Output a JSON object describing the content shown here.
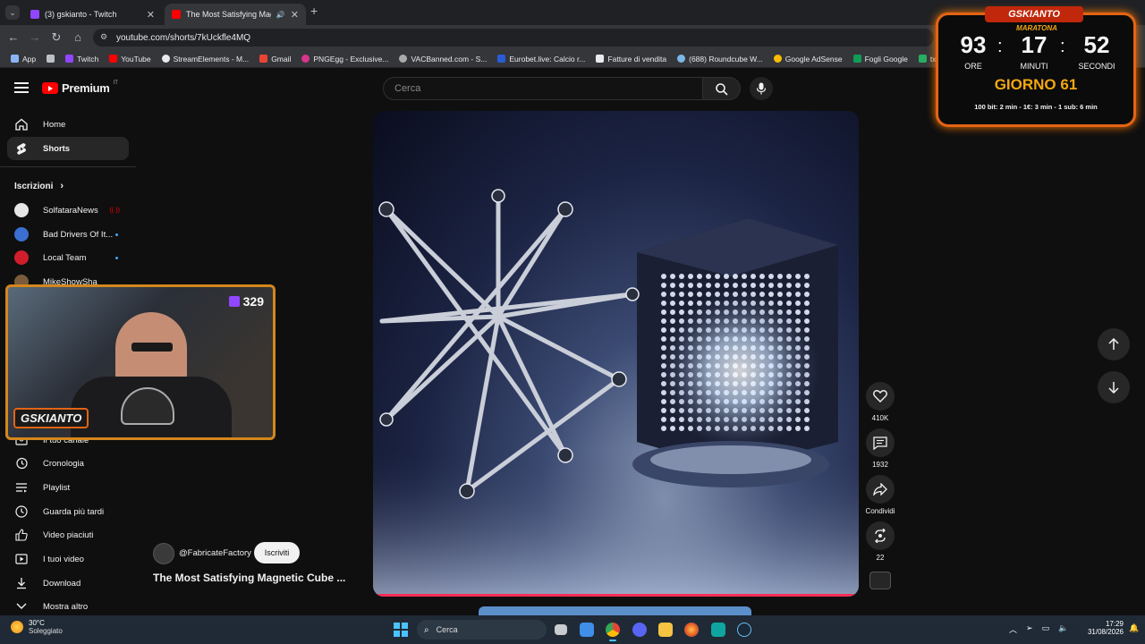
{
  "browser": {
    "tabs": [
      {
        "title": "(3) gskianto - Twitch",
        "favicon_color": "#9146ff"
      },
      {
        "title": "The Most Satisfying Magne",
        "favicon_color": "#ff0000"
      }
    ],
    "new_tab": "+",
    "url": "youtube.com/shorts/7kUckfle4MQ",
    "bookmarks": [
      {
        "label": "App",
        "color": "#8ab4f8"
      },
      {
        "label": "Twitch",
        "color": "#9146ff"
      },
      {
        "label": "YouTube",
        "color": "#ff0000"
      },
      {
        "label": "StreamElements - M...",
        "color": "#e8eaed"
      },
      {
        "label": "Gmail",
        "color": "#ea4335"
      },
      {
        "label": "PNGEgg - Exclusive...",
        "color": "#d8358b"
      },
      {
        "label": "VACBanned.com - S...",
        "color": "#aaaaaa"
      },
      {
        "label": "Eurobet.live: Calcio r...",
        "color": "#2a5bd7"
      },
      {
        "label": "Fatture di vendita",
        "color": "#e8eaed"
      },
      {
        "label": "(688) Roundcube W...",
        "color": "#7cb7e8"
      },
      {
        "label": "Google AdSense",
        "color": "#fbbc04"
      },
      {
        "label": "Fogli Google",
        "color": "#0f9d58"
      },
      {
        "label": "txAdmin",
        "color": "#27ae60"
      }
    ]
  },
  "youtube": {
    "logo": "Premium",
    "logo_region": "IT",
    "search_placeholder": "Cerca",
    "sidebar": {
      "main": [
        {
          "label": "Home",
          "icon": "home-icon"
        },
        {
          "label": "Shorts",
          "icon": "shorts-icon",
          "active": true
        }
      ],
      "subscriptions_title": "Iscrizioni",
      "subscriptions": [
        {
          "label": "SolfataraNews",
          "color": "#e6e6e6",
          "live": true
        },
        {
          "label": "Bad Drivers Of It...",
          "color": "#3b6fd1"
        },
        {
          "label": "Local Team",
          "color": "#d01e2c"
        },
        {
          "label": "MikeShowSha",
          "color": "#7a5c3c"
        }
      ],
      "you_items": [
        {
          "label": "Il tuo canale",
          "icon": "channel-icon"
        },
        {
          "label": "Cronologia",
          "icon": "history-icon"
        },
        {
          "label": "Playlist",
          "icon": "playlist-icon"
        },
        {
          "label": "Guarda più tardi",
          "icon": "watch-later-icon"
        },
        {
          "label": "Video piaciuti",
          "icon": "thumb-up-icon"
        },
        {
          "label": "I tuoi video",
          "icon": "your-videos-icon"
        },
        {
          "label": "Download",
          "icon": "download-icon"
        },
        {
          "label": "Mostra altro",
          "icon": "chevron-down-icon"
        }
      ]
    },
    "short": {
      "channel": "@FabricateFactory",
      "subscribe": "Iscriviti",
      "title": "The Most Satisfying Magnetic Cube ...",
      "likes": "410K",
      "comments": "1932",
      "share": "Condividi",
      "remix": "22"
    }
  },
  "stream_overlay": {
    "viewer_count": "329",
    "streamer_name": "GSKIANTO",
    "timer": {
      "brand": "GSKIANTO",
      "subtitle": "MARATONA",
      "hours": "93",
      "minutes": "17",
      "seconds": "52",
      "hours_label": "ORE",
      "minutes_label": "MINUTI",
      "seconds_label": "SECONDI",
      "day": "GIORNO 61",
      "rates": "100 bit: 2 min - 1€: 3 min - 1 sub: 6 min"
    }
  },
  "taskbar": {
    "weather_temp": "30°C",
    "weather_desc": "Soleggiato",
    "search_placeholder": "Cerca",
    "time": "17:29",
    "date": "31/08/2026"
  },
  "colors": {
    "yt_red": "#ff0000",
    "accent_orange": "#e36414",
    "timer_yellow": "#f3a712"
  }
}
